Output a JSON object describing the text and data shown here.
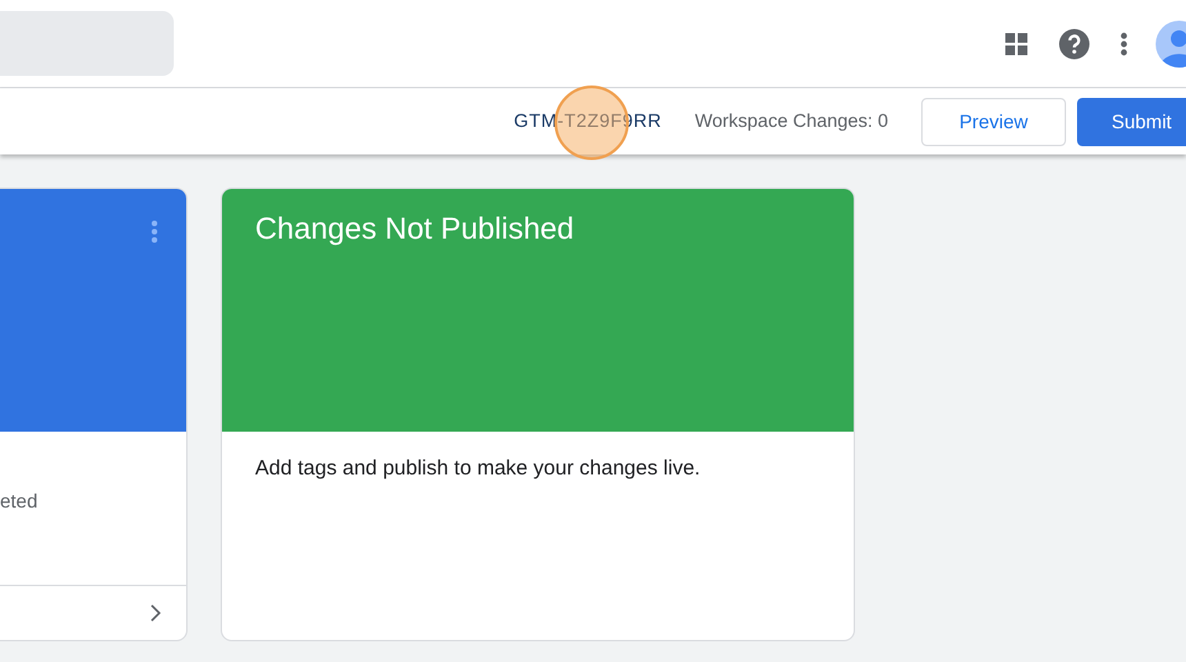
{
  "top_bar": {
    "search": {
      "kind": "field"
    }
  },
  "workspace_bar": {
    "container_id": "GTM-T2Z9F9RR",
    "changes": "Workspace Changes: 0",
    "buttons": [
      {
        "label": "Preview",
        "kind": "outline"
      },
      {
        "label": "Submit",
        "kind": "primary"
      }
    ]
  },
  "cards": [
    {
      "color": "#3073e0",
      "status": "eted",
      "menu": true,
      "footer": true
    },
    {
      "color": "#34a853",
      "title": "Changes Not Published",
      "status": "Add tags and publish to make your changes live.",
      "menu": false,
      "footer": false
    }
  ]
}
